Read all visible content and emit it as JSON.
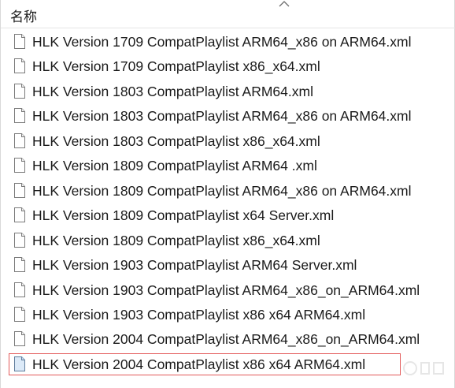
{
  "header": {
    "column_label": "名称",
    "sort_icon": "chevron-up-icon"
  },
  "files": [
    {
      "name": "HLK Version 1709 CompatPlaylist ARM64_x86 on ARM64.xml",
      "icon": "document-icon",
      "selected": false
    },
    {
      "name": "HLK Version 1709 CompatPlaylist x86_x64.xml",
      "icon": "document-icon",
      "selected": false
    },
    {
      "name": "HLK Version 1803 CompatPlaylist ARM64.xml",
      "icon": "document-icon",
      "selected": false
    },
    {
      "name": "HLK Version 1803 CompatPlaylist ARM64_x86 on ARM64.xml",
      "icon": "document-icon",
      "selected": false
    },
    {
      "name": "HLK Version 1803 CompatPlaylist x86_x64.xml",
      "icon": "document-icon",
      "selected": false
    },
    {
      "name": "HLK Version 1809 CompatPlaylist ARM64 .xml",
      "icon": "document-icon",
      "selected": false
    },
    {
      "name": "HLK Version 1809 CompatPlaylist ARM64_x86 on ARM64.xml",
      "icon": "document-icon",
      "selected": false
    },
    {
      "name": "HLK Version 1809 CompatPlaylist x64 Server.xml",
      "icon": "document-icon",
      "selected": false
    },
    {
      "name": "HLK Version 1809 CompatPlaylist x86_x64.xml",
      "icon": "document-icon",
      "selected": false
    },
    {
      "name": "HLK Version 1903 CompatPlaylist ARM64 Server.xml",
      "icon": "document-icon",
      "selected": false
    },
    {
      "name": "HLK Version 1903 CompatPlaylist ARM64_x86_on_ARM64.xml",
      "icon": "document-icon",
      "selected": false
    },
    {
      "name": "HLK Version 1903 CompatPlaylist x86 x64 ARM64.xml",
      "icon": "document-icon",
      "selected": false
    },
    {
      "name": "HLK Version 2004 CompatPlaylist ARM64_x86_on_ARM64.xml",
      "icon": "document-icon",
      "selected": false
    },
    {
      "name": "HLK Version 2004 CompatPlaylist x86 x64 ARM64.xml",
      "icon": "document-icon",
      "selected": true
    }
  ],
  "colors": {
    "selection_outline": "#e35a5a",
    "text": "#1a1a1a",
    "background": "#ffffff"
  }
}
